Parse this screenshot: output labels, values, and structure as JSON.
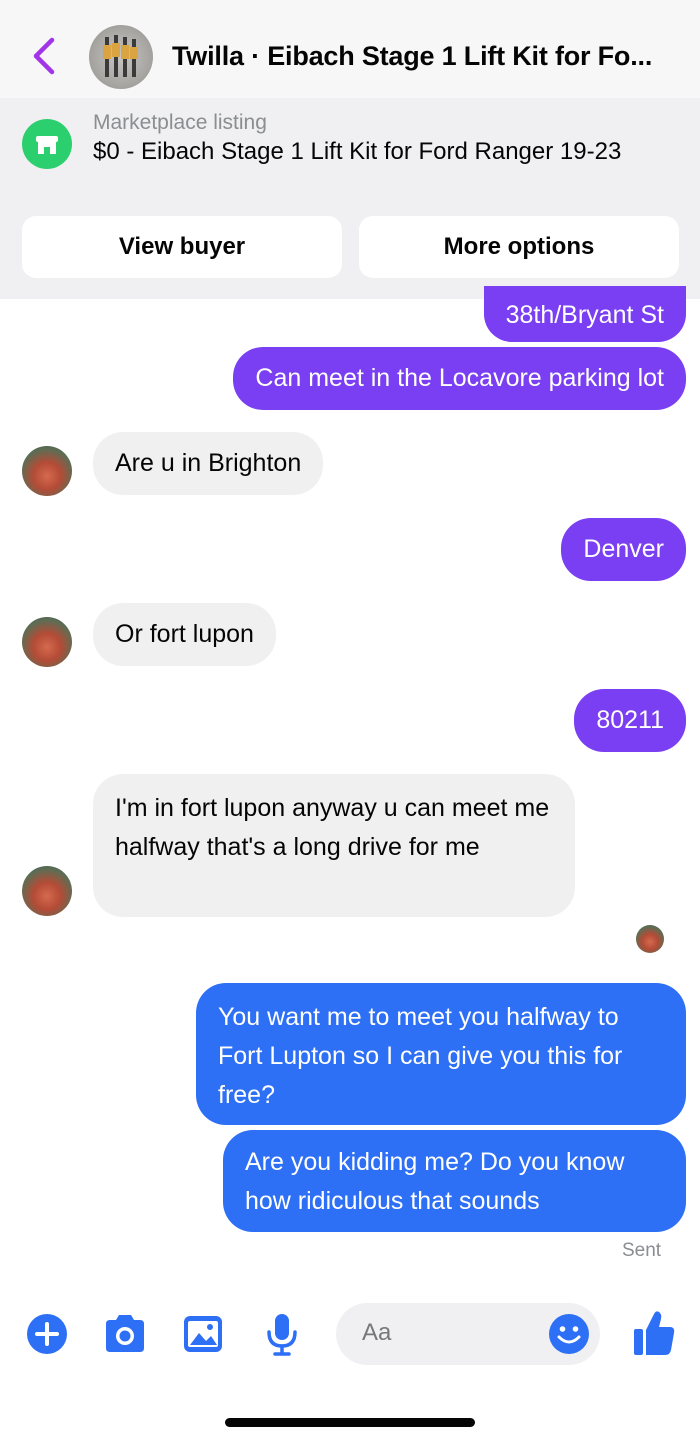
{
  "header": {
    "title": "Twilla · Eibach Stage 1 Lift Kit for Fo..."
  },
  "listing": {
    "subtitle": "Marketplace listing",
    "title": "$0 - Eibach Stage 1 Lift Kit for Ford Ranger 19-23",
    "view_buyer_label": "View buyer",
    "more_options_label": "More options"
  },
  "messages": [
    {
      "sender": "me",
      "text": "38th/Bryant St"
    },
    {
      "sender": "me",
      "text": "Can meet in the Locavore parking lot"
    },
    {
      "sender": "them",
      "text": "Are u in Brighton"
    },
    {
      "sender": "me",
      "text": "Denver"
    },
    {
      "sender": "them",
      "text": "Or fort lupon"
    },
    {
      "sender": "me",
      "text": "80211"
    },
    {
      "sender": "them",
      "text": "I'm in fort lupon anyway u can meet me halfway that's a long drive for me"
    },
    {
      "sender": "me",
      "text": "You want me to meet you halfway to Fort Lupton so I can give you this for free?"
    },
    {
      "sender": "me",
      "text": "Are you kidding me? Do you know how ridiculous that sounds"
    }
  ],
  "status": {
    "sent_label": "Sent"
  },
  "composer": {
    "placeholder": "Aa",
    "icons": [
      "plus-icon",
      "camera-icon",
      "image-icon",
      "microphone-icon",
      "emoji-icon",
      "thumbs-up-icon"
    ]
  },
  "colors": {
    "accent_purple": "#7a3ff2",
    "accent_blue": "#2d6ff5",
    "marketplace_green": "#2ccf6e",
    "back_arrow": "#a335e8"
  }
}
